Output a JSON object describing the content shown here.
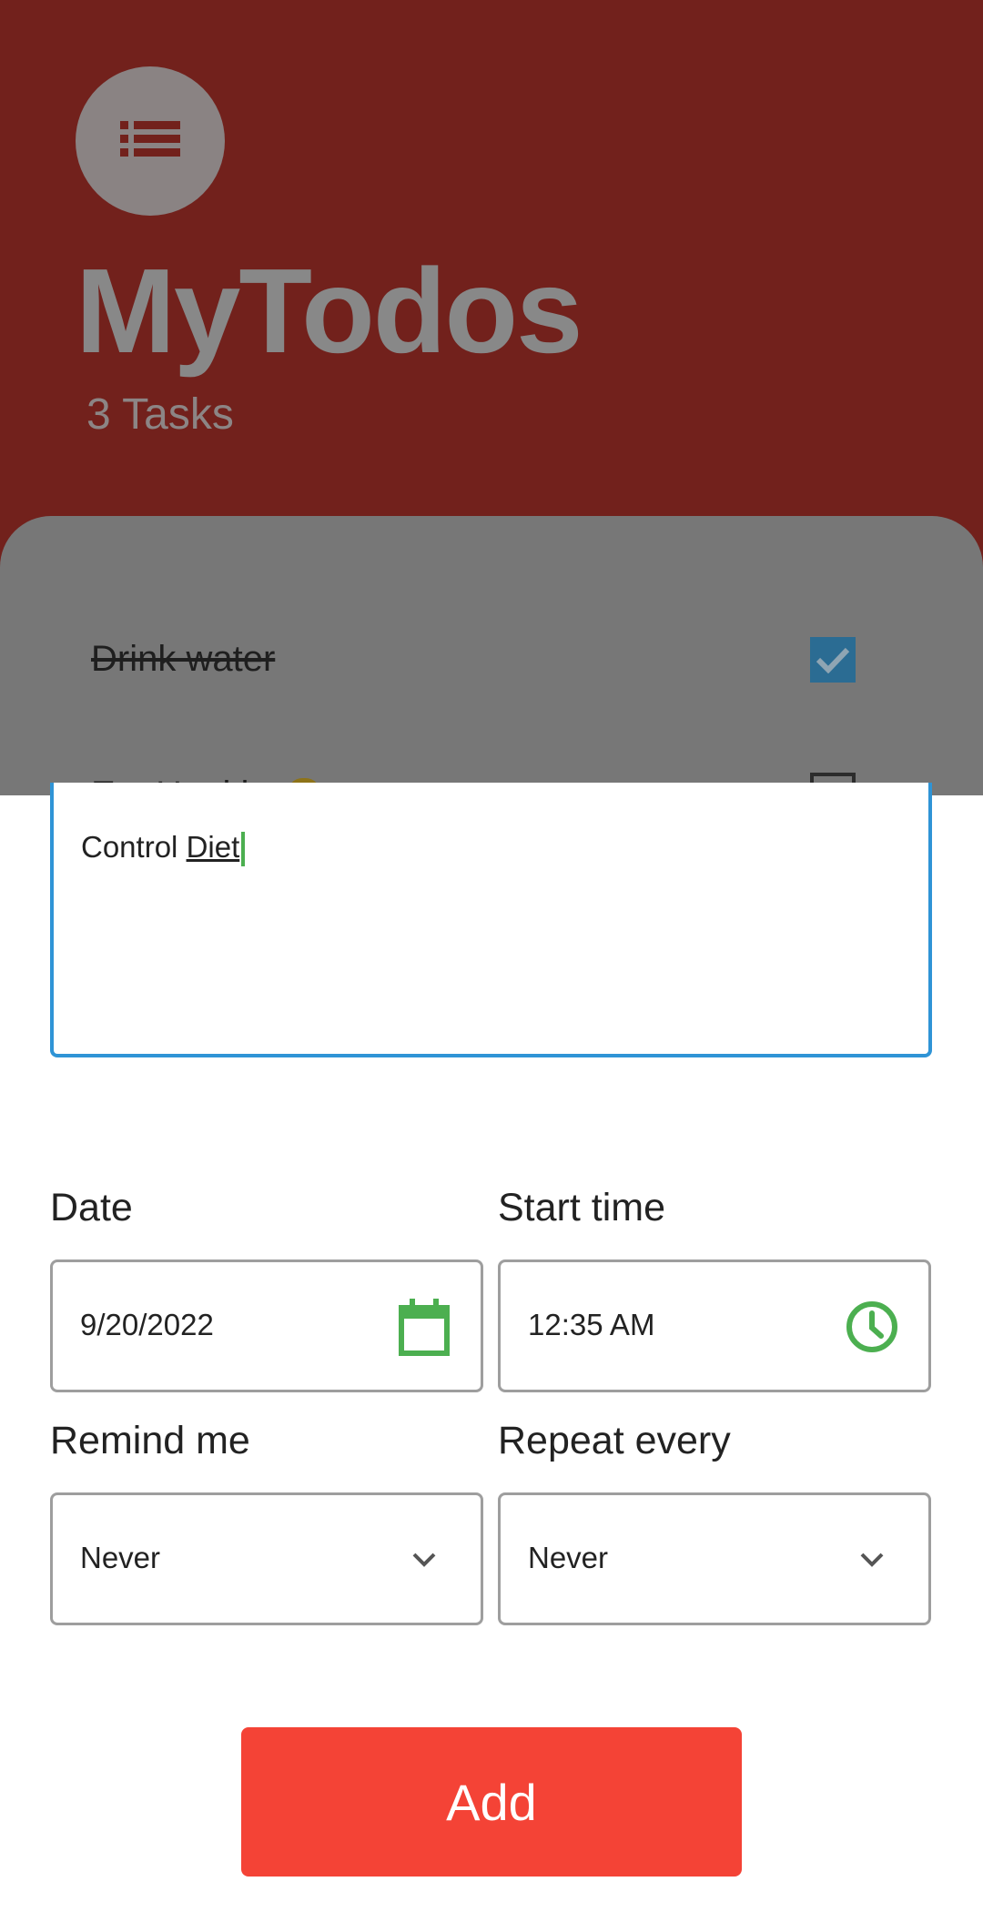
{
  "app": {
    "title": "MyTodos",
    "task_count": "3 Tasks",
    "menu_icon": "list-icon"
  },
  "todos": [
    {
      "text": "Drink water",
      "done": true
    },
    {
      "text": "Eat Healthy",
      "done": false
    }
  ],
  "form": {
    "description_prefix": "Control ",
    "description_word": "Diet",
    "date_label": "Date",
    "date_value": "9/20/2022",
    "start_time_label": "Start time",
    "start_time_value": "12:35 AM",
    "remind_label": "Remind me",
    "remind_value": "Never",
    "repeat_label": "Repeat every",
    "repeat_value": "Never",
    "add_label": "Add"
  },
  "colors": {
    "accent_green": "#4caf50",
    "focus_blue": "#2f94d6",
    "add_red": "#f44336",
    "header_red_dimmed": "#72211c"
  }
}
